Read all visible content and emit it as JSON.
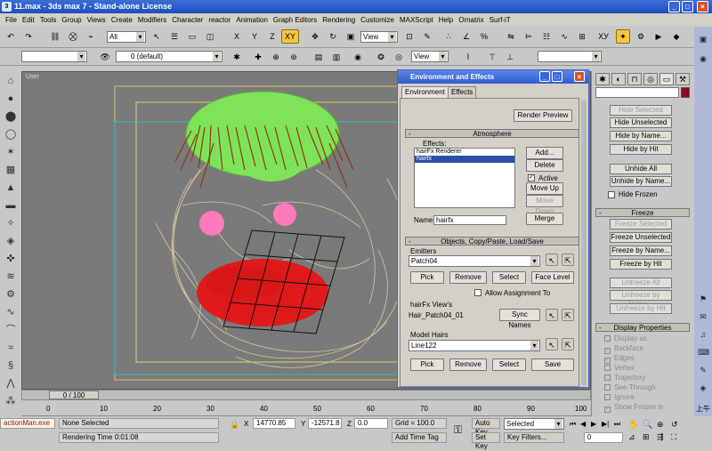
{
  "window": {
    "title": "11.max - 3ds max 7 - Stand-alone License"
  },
  "menu": [
    "File",
    "Edit",
    "Tools",
    "Group",
    "Views",
    "Create",
    "Modifiers",
    "Character",
    "reactor",
    "Animation",
    "Graph Editors",
    "Rendering",
    "Customize",
    "MAXScript",
    "Help",
    "Ornatrix",
    "Surf-iT"
  ],
  "toolbar": {
    "selection_filter": "All",
    "ref_coord": "View",
    "axis_x": "X",
    "axis_y": "Y",
    "axis_z": "Z",
    "axis_xy": "XY",
    "named_selection": "",
    "layer": "0 (default)",
    "view_dropdown": "View"
  },
  "viewport": {
    "label": "User"
  },
  "timeline": {
    "slider_label": "0 / 100",
    "ticks": [
      "0",
      "10",
      "20",
      "30",
      "40",
      "50",
      "60",
      "70",
      "80",
      "90",
      "100"
    ]
  },
  "status": {
    "maxscript": "actionMan.exe",
    "selection": "None Selected",
    "rendering_time": "Rendering Time  0:01:08",
    "x_label": "X",
    "x_value": "14770.85",
    "y_label": "Y",
    "y_value": "-12571.8",
    "z_label": "Z",
    "z_value": "0.0",
    "grid": "Grid = 100.0",
    "add_time_tag": "Add Time Tag",
    "auto_key": "Auto Key",
    "set_key": "Set Key",
    "key_mode": "Selected",
    "key_filters": "Key Filters...",
    "frame": "0"
  },
  "dialog": {
    "title": "Environment and Effects",
    "tabs": [
      "Environment",
      "Effects"
    ],
    "render_preview": "Render Preview",
    "atmosphere": {
      "header": "Atmosphere",
      "effects_label": "Effects:",
      "items": [
        "hairFx Renderer",
        "hairfx"
      ],
      "add": "Add...",
      "delete": "Delete",
      "active": "Active",
      "move_up": "Move Up",
      "move_down": "Move Down",
      "name_label": "Name:",
      "name_value": "hairfx",
      "merge": "Merge"
    },
    "objects": {
      "header": "Objects, Copy/Paste, Load/Save",
      "emitters_label": "Emitters",
      "emitter_value": "Patch04",
      "pick": "Pick",
      "remove": "Remove",
      "select": "Select",
      "face_level": "Face Level",
      "allow_assignment": "Allow Assignment To",
      "view_group": "hairFx View's",
      "view_value": "Hair_Patch04_01",
      "sync_names": "Sync Names",
      "model_hairs": "Model Hairs",
      "model_value": "Line122",
      "pick2": "Pick",
      "remove2": "Remove",
      "select2": "Select",
      "save": "Save"
    }
  },
  "right_panel": {
    "color": "#8b0a2a",
    "hide_header": "",
    "hide_buttons": [
      "Hide Selected",
      "Hide Unselected",
      "Hide by Name...",
      "Hide by Hit",
      "Unhide All",
      "Unhide by Name..."
    ],
    "hide_frozen": "Hide Frozen",
    "freeze_header": "Freeze",
    "freeze_buttons": [
      "Freeze Selected",
      "Freeze Unselected",
      "Freeze by Name...",
      "Freeze by Hit",
      "Unfreeze All",
      "Unfreeze by Name...",
      "Unfreeze by Hit"
    ],
    "display_header": "Display Properties",
    "display_props": [
      "Display as",
      "Backface",
      "Edges",
      "Vertex",
      "Trajectory",
      "See-Through",
      "Ignore",
      "Show Frozen in"
    ]
  },
  "clock": "上午"
}
